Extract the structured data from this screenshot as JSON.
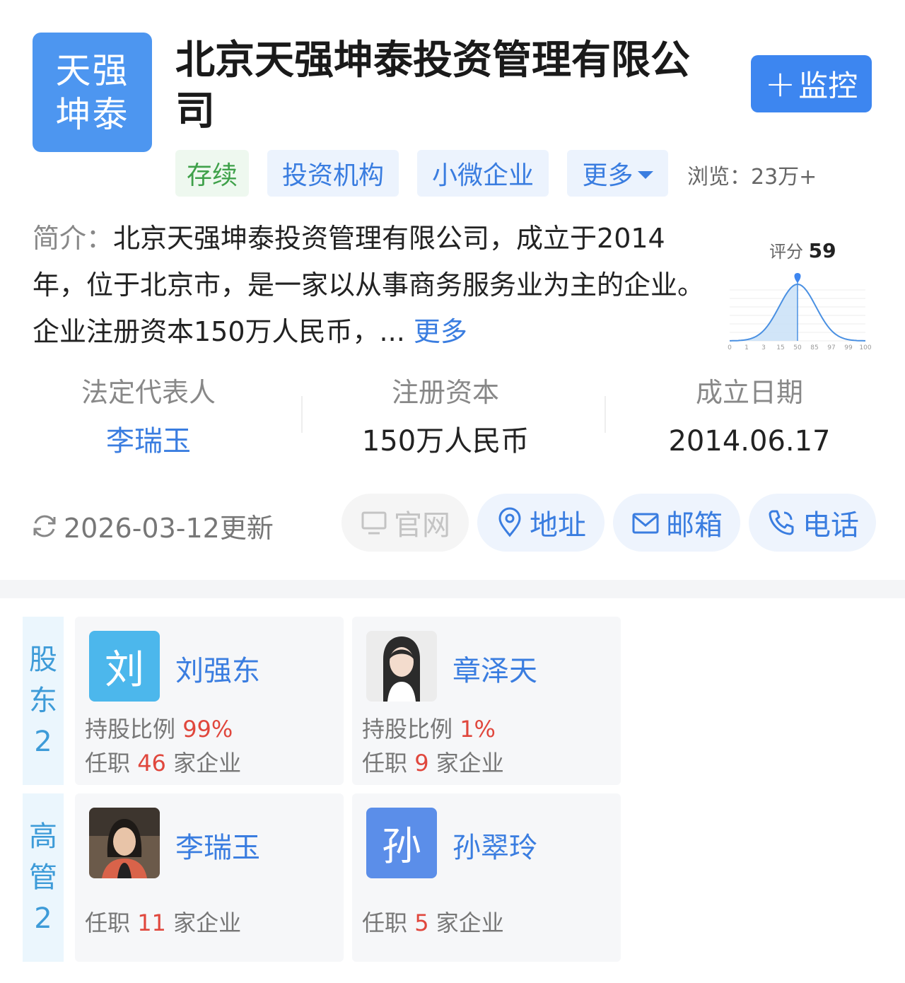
{
  "company": {
    "logo_line1": "天强",
    "logo_line2": "坤泰",
    "name": "北京天强坤泰投资管理有限公司",
    "monitor_plus": "+",
    "monitor_label": "监控"
  },
  "tags": {
    "status": "存续",
    "type": "投资机构",
    "scale": "小微企业",
    "more": "更多"
  },
  "views": "浏览：23万+",
  "intro": {
    "label": "简介：",
    "text": "北京天强坤泰投资管理有限公司，成立于2014年，位于北京市，是一家以从事商务服务业为主的企业。企业注册资本150万人民币，...",
    "more": "更多"
  },
  "score": {
    "label": "评分",
    "value": "59",
    "value_num": 59,
    "ticks": [
      "0",
      "1",
      "3",
      "15",
      "50",
      "85",
      "97",
      "99",
      "100"
    ]
  },
  "stats": {
    "legal_rep_label": "法定代表人",
    "legal_rep_value": "李瑞玉",
    "capital_label": "注册资本",
    "capital_value": "150万人民币",
    "date_label": "成立日期",
    "date_value": "2014.06.17"
  },
  "update_text": "2026-03-12更新",
  "actions": {
    "website": "官网",
    "address": "地址",
    "email": "邮箱",
    "phone": "电话"
  },
  "shareholders": {
    "label_chars": [
      "股",
      "东"
    ],
    "count": "2",
    "items": [
      {
        "avatar_char": "刘",
        "name": "刘强东",
        "ratio_label": "持股比例",
        "ratio": "99%",
        "job_prefix": "任职",
        "job_count": "46",
        "job_suffix": "家企业"
      },
      {
        "avatar_char": "",
        "name": "章泽天",
        "ratio_label": "持股比例",
        "ratio": "1%",
        "job_prefix": "任职",
        "job_count": "9",
        "job_suffix": "家企业"
      }
    ]
  },
  "executives": {
    "label_chars": [
      "高",
      "管"
    ],
    "count": "2",
    "items": [
      {
        "avatar_char": "",
        "name": "李瑞玉",
        "job_prefix": "任职",
        "job_count": "11",
        "job_suffix": "家企业"
      },
      {
        "avatar_char": "孙",
        "name": "孙翠玲",
        "job_prefix": "任职",
        "job_count": "5",
        "job_suffix": "家企业"
      }
    ]
  },
  "colors": {
    "brand_blue": "#3a7de0",
    "logo_blue": "#4d96f0",
    "status_green": "#3fa14a",
    "highlight_red": "#e0473d"
  }
}
